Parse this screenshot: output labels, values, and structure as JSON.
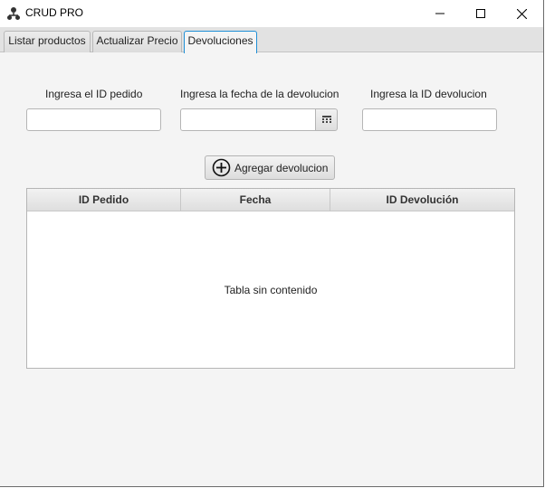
{
  "window": {
    "title": "CRUD PRO",
    "icon": "app-network-icon",
    "controls": [
      "minimize-icon",
      "maximize-icon",
      "close-icon"
    ]
  },
  "tabs": [
    {
      "label": "Listar productos",
      "selected": false
    },
    {
      "label": "Actualizar Precio",
      "selected": false
    },
    {
      "label": "Devoluciones",
      "selected": true
    }
  ],
  "form": {
    "pedido_id": {
      "label": "Ingresa el ID pedido",
      "value": ""
    },
    "fecha": {
      "label": "Ingresa la fecha de la devolucion",
      "value": "",
      "picker_icon": "calendar-icon"
    },
    "devolucion_id": {
      "label": "Ingresa la ID devolucion",
      "value": ""
    }
  },
  "add_button": {
    "label": "Agregar devolucion",
    "icon": "plus-circle-icon"
  },
  "table": {
    "columns": [
      "ID Pedido",
      "Fecha",
      "ID Devolución"
    ],
    "rows": [],
    "empty_message": "Tabla sin contenido"
  },
  "colors": {
    "selected_tab_border": "#1e8fd6",
    "background": "#f4f4f4"
  }
}
